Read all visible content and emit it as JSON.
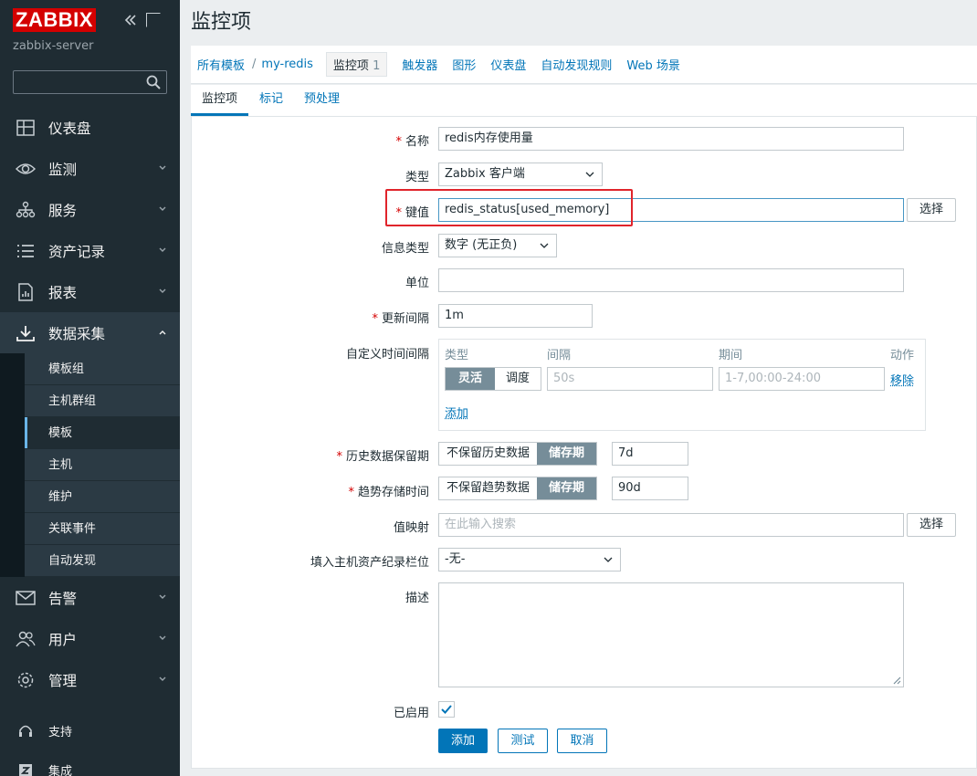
{
  "sidebar": {
    "logo": "ZABBIX",
    "server": "zabbix-server",
    "search_value": "",
    "nav": [
      {
        "label": "仪表盘",
        "icon": "dashboard-icon"
      },
      {
        "label": "监测",
        "icon": "eye-icon"
      },
      {
        "label": "服务",
        "icon": "services-icon"
      },
      {
        "label": "资产记录",
        "icon": "list-icon"
      },
      {
        "label": "报表",
        "icon": "report-icon"
      },
      {
        "label": "数据采集",
        "icon": "download-icon"
      }
    ],
    "sub_items": [
      "模板组",
      "主机群组",
      "模板",
      "主机",
      "维护",
      "关联事件",
      "自动发现"
    ],
    "nav2": [
      {
        "label": "告警",
        "icon": "mail-icon"
      },
      {
        "label": "用户",
        "icon": "users-icon"
      },
      {
        "label": "管理",
        "icon": "gear-icon"
      }
    ],
    "bottom": [
      {
        "label": "支持",
        "icon": "headset-icon"
      },
      {
        "label": "集成",
        "icon": "integration-icon"
      }
    ]
  },
  "page": {
    "title": "监控项"
  },
  "breadcrumb": {
    "all_templates": "所有模板",
    "sep": "/",
    "template": "my-redis",
    "tabs": [
      {
        "label": "监控项",
        "count": "1"
      },
      {
        "label": "触发器"
      },
      {
        "label": "图形"
      },
      {
        "label": "仪表盘"
      },
      {
        "label": "自动发现规则"
      },
      {
        "label": "Web 场景"
      }
    ]
  },
  "tabs": [
    "监控项",
    "标记",
    "预处理"
  ],
  "form": {
    "name_label": "名称",
    "name_value": "redis内存使用量",
    "type_label": "类型",
    "type_value": "Zabbix 客户端",
    "key_label": "键值",
    "key_value": "redis_status[used_memory]",
    "select_label": "选择",
    "info_type_label": "信息类型",
    "info_type_value": "数字 (无正负)",
    "unit_label": "单位",
    "unit_value": "",
    "interval_label": "更新间隔",
    "interval_value": "1m",
    "custom_label": "自定义时间间隔",
    "custom": {
      "col_type": "类型",
      "col_interval": "间隔",
      "col_period": "期间",
      "col_action": "动作",
      "flexible": "灵活",
      "scheduling": "调度",
      "interval_placeholder": "50s",
      "period_placeholder": "1-7,00:00-24:00",
      "remove": "移除",
      "add": "添加"
    },
    "history_label": "历史数据保留期",
    "history_opt1": "不保留历史数据",
    "history_opt2": "储存期",
    "history_value": "7d",
    "trends_label": "趋势存储时间",
    "trends_opt1": "不保留趋势数据",
    "trends_opt2": "储存期",
    "trends_value": "90d",
    "valuemap_label": "值映射",
    "valuemap_placeholder": "在此输入搜索",
    "inventory_label": "填入主机资产纪录栏位",
    "inventory_value": "-无-",
    "desc_label": "描述",
    "enabled_label": "已启用",
    "add_btn": "添加",
    "test_btn": "测试",
    "cancel_btn": "取消"
  },
  "colors": {
    "accent": "#0275b8",
    "logo": "#d40000",
    "sidebar": "#1f2c33",
    "highlight": "#e0242b"
  }
}
